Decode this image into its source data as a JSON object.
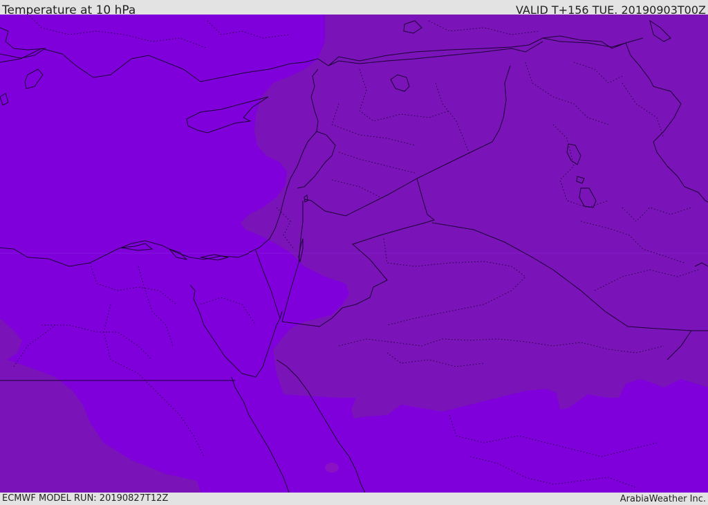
{
  "header": {
    "title": "Temperature at 10 hPa",
    "valid": "VALID T+156 TUE. 20190903T00Z"
  },
  "footer": {
    "model_run": "ECMWF MODEL RUN: 20190827T12Z",
    "credit": "ArabiaWeather Inc."
  },
  "map": {
    "field_colors": {
      "cooler_band": "#8000dc",
      "warmer_band": "#7a13b8"
    },
    "coastline_color": "#1a0033",
    "border_style": "solid",
    "province_style": "dotted"
  }
}
